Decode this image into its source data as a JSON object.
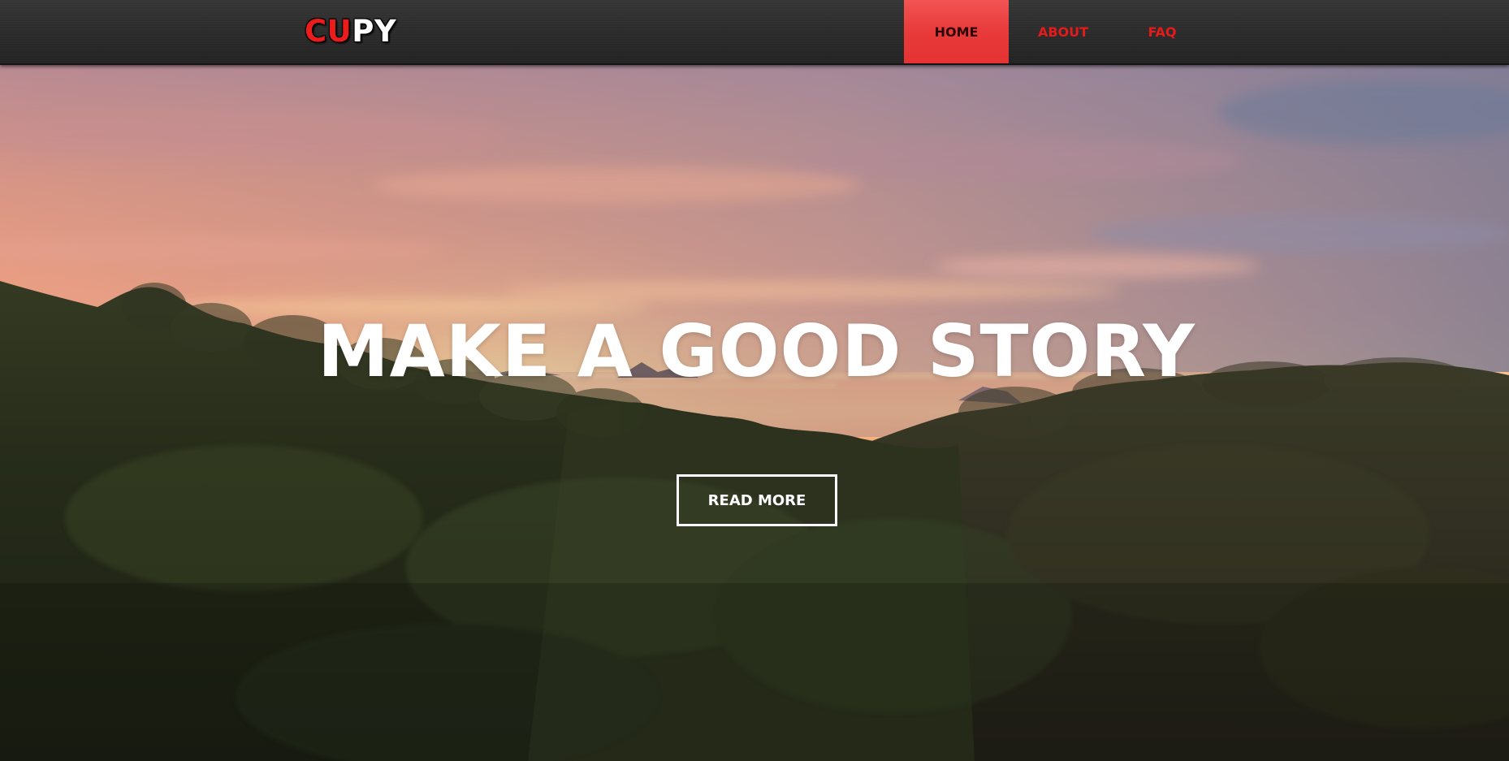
{
  "brand": {
    "logo_red": "CU",
    "logo_white": "PY",
    "accent_color": "#ed1c1c"
  },
  "nav": {
    "items": [
      {
        "label": "HOME",
        "active": true
      },
      {
        "label": "ABOUT",
        "active": false
      },
      {
        "label": "FAQ",
        "active": false
      }
    ]
  },
  "hero": {
    "headline": "MAKE A GOOD STORY",
    "cta_label": "READ MORE",
    "background": "sunset-over-forested-hills"
  }
}
